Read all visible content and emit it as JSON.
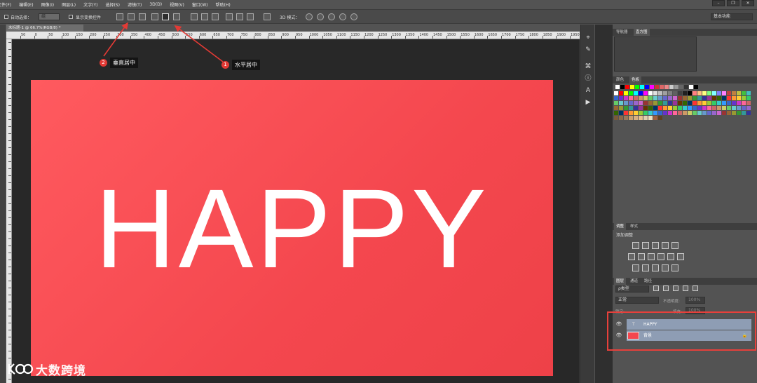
{
  "menu": [
    "文件(F)",
    "编辑(E)",
    "图像(I)",
    "图层(L)",
    "文字(Y)",
    "选择(S)",
    "滤镜(T)",
    "3D(D)",
    "视图(V)",
    "窗口(W)",
    "帮助(H)"
  ],
  "options": {
    "auto_select_label": "自动选择：",
    "auto_select_value": "组",
    "show_transform_label": "显示变换控件",
    "mode_3d_label": "3D 模式：",
    "workspace": "基本功能"
  },
  "document": {
    "tab_title": "未标题-1 @ 66.7%(RGB/8) *",
    "ruler_labels": [
      "50",
      "0",
      "50",
      "100",
      "150",
      "200",
      "250",
      "300",
      "350",
      "400",
      "450",
      "500",
      "550",
      "600",
      "650",
      "700",
      "750",
      "800",
      "850",
      "900",
      "950",
      "1000",
      "1050",
      "1100",
      "1150",
      "1200",
      "1250",
      "1300",
      "1350",
      "1400",
      "1450",
      "1500",
      "1550",
      "1600",
      "1650",
      "1700",
      "1750",
      "1800",
      "1850",
      "1900",
      "1950"
    ],
    "canvas_text": "HAPPY",
    "canvas_color": "#f4474e"
  },
  "annotations": {
    "a1": {
      "number": "2",
      "label": "垂直居中"
    },
    "a2": {
      "number": "1",
      "label": "水平居中"
    }
  },
  "panels": {
    "navigator_tabs": [
      "导航器",
      "直方图"
    ],
    "swatch_tabs": [
      "颜色",
      "色板"
    ],
    "adjust_tabs": [
      "调整",
      "样式"
    ],
    "adjust_title": "添加调整",
    "layers_tabs": [
      "图层",
      "通道",
      "路径"
    ],
    "filter_kind": "ρ类型",
    "blend_mode": "正常",
    "opacity_label": "不透明度:",
    "opacity_value": "100%",
    "lock_label": "锁定:",
    "fill_label": "填充:",
    "fill_value": "100%",
    "layers": [
      {
        "name": "HAPPY",
        "type": "text"
      },
      {
        "name": "背景",
        "type": "background"
      }
    ]
  },
  "watermark": "大数跨境"
}
